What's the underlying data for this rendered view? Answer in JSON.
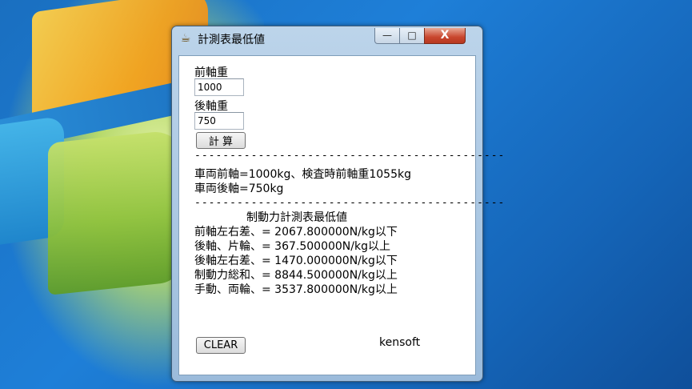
{
  "window": {
    "title": "計測表最低値",
    "minimize_glyph": "—",
    "maximize_glyph": "□",
    "close_glyph": "X",
    "app_icon": "coffee-cup-icon"
  },
  "form": {
    "front_axle_label": "前軸重",
    "front_axle_value": "1000",
    "rear_axle_label": "後軸重",
    "rear_axle_value": "750",
    "calc_button": "計 算",
    "clear_button": "CLEAR"
  },
  "divider_text": "--------------------------------------------",
  "results": {
    "line1": "車両前軸=1000kg、検査時前軸重1055kg",
    "line2": "車両後軸=750kg"
  },
  "table": {
    "heading": "制動力計測表最低値",
    "rows": [
      "前軸左右差、= 2067.800000N/kg以下",
      "後軸、片輪、= 367.500000N/kg以上",
      "後軸左右差、= 1470.000000N/kg以下",
      "制動力総和、= 8844.500000N/kg以上",
      "手動、両輪、= 3537.800000N/kg以上"
    ]
  },
  "credit": "kensoft"
}
